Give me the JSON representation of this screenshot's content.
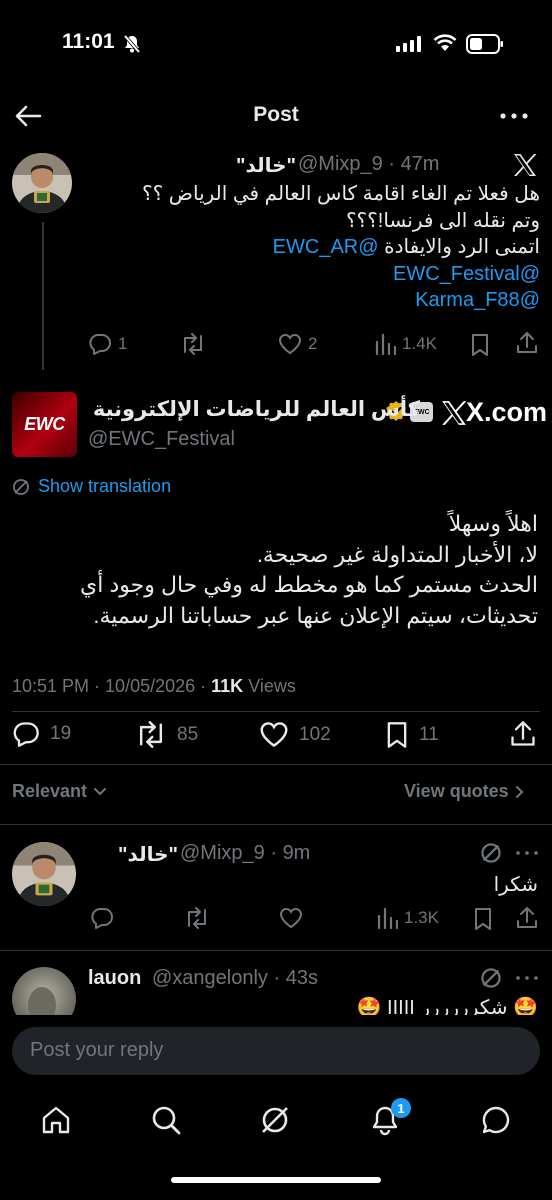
{
  "status_bar": {
    "time": "11:01"
  },
  "header": {
    "title": "Post"
  },
  "parent_post": {
    "display_name": "\"خالد\"",
    "handle": "@Mixp_9",
    "time": "47m",
    "lines": [
      "هل فعلا تم الغاء اقامة  كاس العالم في الرياض ؟؟",
      "وتم نقله الى فرنسا!؟؟؟",
      "اتمنى الرد والايفادة"
    ],
    "mention_inline": "@EWC_AR",
    "mentions": [
      "@EWC_Festival",
      "@Karma_F88"
    ],
    "actions": {
      "replies": "1",
      "reposts": "",
      "likes": "2",
      "views": "1.4K"
    }
  },
  "main_post": {
    "logo_text": "EWC",
    "display_name": "كأس العالم للرياضات الإلكترونية",
    "badge_text": "EWC",
    "xcom": "X.com",
    "handle": "@EWC_Festival",
    "translate": "Show translation",
    "lines": [
      "اهلاً وسهلاً",
      "لا، الأخبار المتداولة غير صحيحة.",
      "الحدث مستمر كما هو مخطط له وفي حال وجود أي",
      "تحديثات، سيتم الإعلان عنها عبر حساباتنا الرسمية."
    ],
    "meta": {
      "time": "10:51 PM",
      "date": "10/05/2026",
      "views_count": "11K",
      "views_label": "Views"
    },
    "actions": {
      "replies": "19",
      "reposts": "85",
      "likes": "102",
      "bookmarks": "11"
    }
  },
  "sort": {
    "relevant": "Relevant",
    "view_quotes": "View quotes"
  },
  "replies": [
    {
      "display_name": "\"خالد\"",
      "handle": "@Mixp_9",
      "time": "9m",
      "text": "شكرا",
      "actions": {
        "replies": "",
        "reposts": "",
        "likes": "",
        "views": "1.3K"
      }
    },
    {
      "display_name": "lauon",
      "handle": "@xangelonly",
      "time": "43s",
      "text": "🤩 شكرررررر IIIII 🤩"
    }
  ],
  "reply_box": {
    "placeholder": "Post your reply"
  },
  "nav": {
    "notifications_badge": "1"
  },
  "colors": {
    "accent": "#1d9bf0",
    "background": "#000000",
    "muted": "#71767b",
    "gold": "#e2b719"
  }
}
